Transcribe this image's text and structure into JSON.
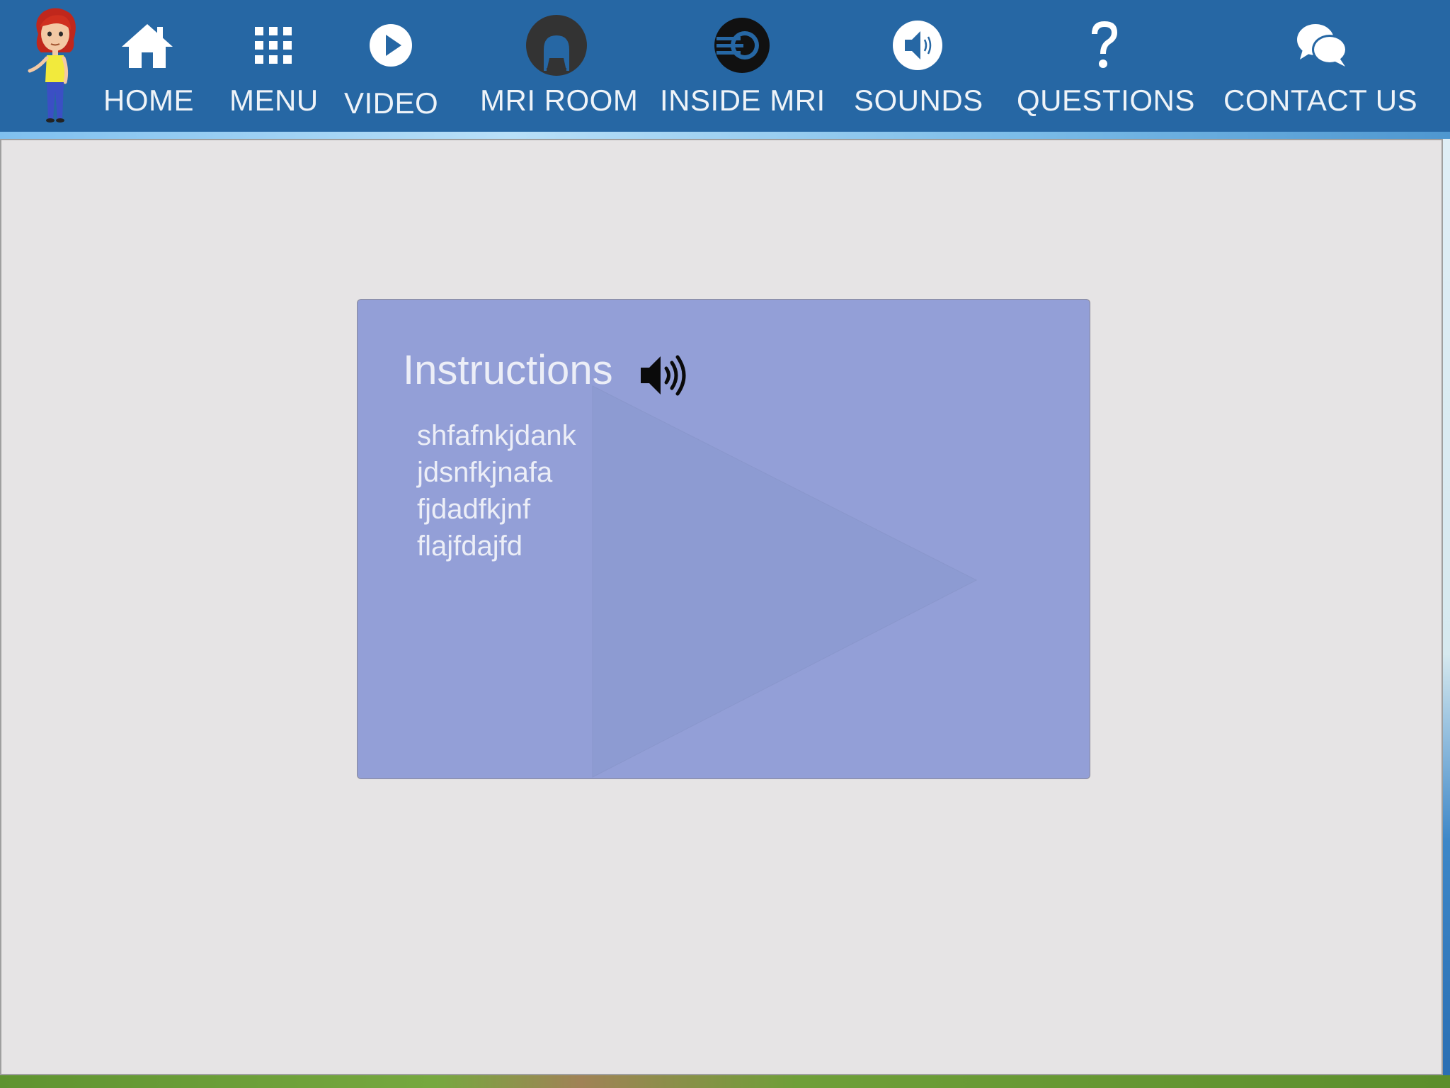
{
  "nav": {
    "items": [
      {
        "key": "home",
        "label": "HOME",
        "icon": "house-icon"
      },
      {
        "key": "menu",
        "label": "MENU",
        "icon": "grid-icon"
      },
      {
        "key": "video",
        "label": "VIDEO",
        "icon": "play-circle-icon"
      },
      {
        "key": "mri-room",
        "label": "MRI ROOM",
        "icon": "mri-scanner-icon"
      },
      {
        "key": "inside-mri",
        "label": "INSIDE MRI",
        "icon": "mri-bore-icon"
      },
      {
        "key": "sounds",
        "label": "SOUNDS",
        "icon": "speaker-circle-icon"
      },
      {
        "key": "questions",
        "label": "QUESTIONS",
        "icon": "question-mark-icon"
      },
      {
        "key": "contact",
        "label": "CONTACT US",
        "icon": "chat-bubbles-icon"
      }
    ]
  },
  "instructions": {
    "title": "Instructions",
    "speaker_icon": "speaker-loud-icon",
    "lines": [
      "shfafnkjdank",
      "jdsnfkjnafa",
      "fjdadfkjnf",
      "flajfdajfd"
    ]
  },
  "colors": {
    "nav_bg": "#2667a4",
    "nav_text": "#eef3f8",
    "content_bg": "#e6e4e5",
    "card_bg": "#939fd7",
    "card_text": "#eceef7"
  }
}
